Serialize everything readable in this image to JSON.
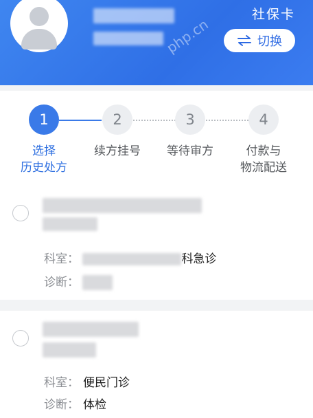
{
  "header": {
    "card_type": "社保卡",
    "switch_label": "切换",
    "watermark": "php.cn",
    "icons": {
      "avatar": "user-avatar-icon",
      "switch": "swap-arrows-icon"
    }
  },
  "steps": [
    {
      "number": "1",
      "label": "选择\n历史处方",
      "active": true
    },
    {
      "number": "2",
      "label": "续方挂号",
      "active": false
    },
    {
      "number": "3",
      "label": "等待审方",
      "active": false
    },
    {
      "number": "4",
      "label": "付款与\n物流配送",
      "active": false
    }
  ],
  "records": [
    {
      "dept_label": "科室：",
      "dept_value": "科急诊",
      "diag_label": "诊断：",
      "diag_value": ""
    },
    {
      "dept_label": "科室：",
      "dept_value": "便民门诊",
      "diag_label": "诊断：",
      "diag_value": "体检"
    }
  ],
  "colors": {
    "primary": "#3a7ae8",
    "header_blue": "#3f86f0",
    "background": "#f2f3f5"
  }
}
